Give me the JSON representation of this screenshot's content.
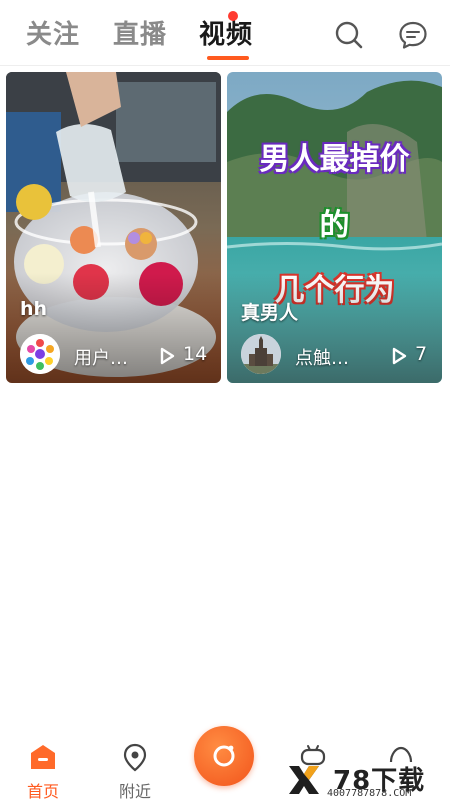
{
  "top_tabs": [
    {
      "label": "关注"
    },
    {
      "label": "直播"
    },
    {
      "label": "视频"
    }
  ],
  "active_tab": "视频",
  "icons": {
    "search": "search-icon",
    "messages": "message-icon"
  },
  "feed": [
    {
      "title": "hh",
      "user": "用户…",
      "plays": "14",
      "thumbnail": "glass-bowl-dessert-photo"
    },
    {
      "title": "真男人",
      "user": "点触…",
      "plays": "7",
      "thumbnail": "tropical-lagoon-photo",
      "overlay_lines": [
        "男人最掉价",
        "的",
        "几个行为"
      ]
    }
  ],
  "bottom_nav": {
    "home": "首页",
    "nearby": "附近"
  },
  "watermark": {
    "text": "78下载",
    "sub": "4007787878.COM"
  },
  "colors": {
    "accent": "#ff5a1f",
    "active_text": "#1a1a1a",
    "inactive_text": "#8a8a8a"
  }
}
